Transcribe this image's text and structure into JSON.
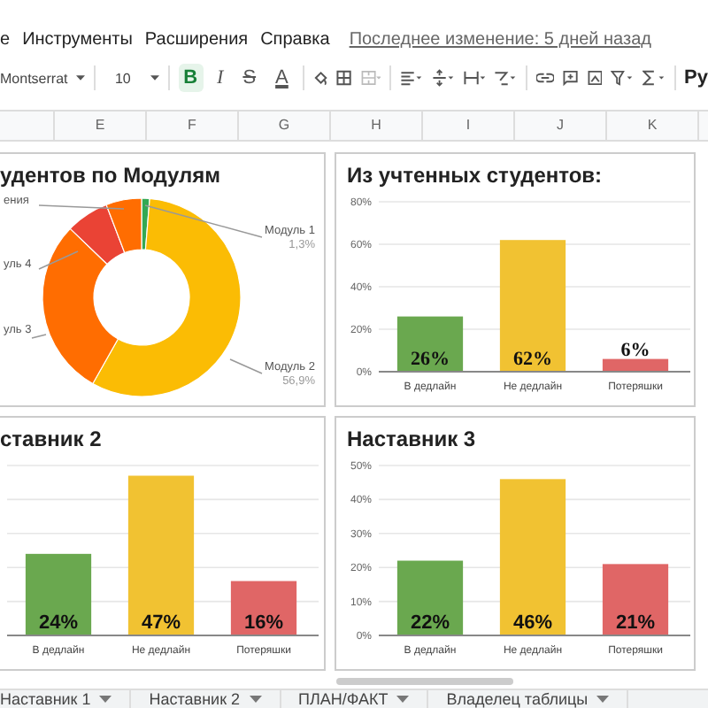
{
  "menu": {
    "items": [
      "е",
      "Инструменты",
      "Расширения",
      "Справка"
    ],
    "last_edit": "Последнее изменение: 5 дней назад"
  },
  "toolbar": {
    "font": "Montserrat",
    "size": "10",
    "format_buttons": [
      {
        "label": "B",
        "selected": true
      },
      {
        "label": "I",
        "selected": false
      },
      {
        "label": "S",
        "selected": false
      },
      {
        "label": "A",
        "selected": false
      }
    ],
    "overflow_text": "Py"
  },
  "columns": [
    "E",
    "F",
    "G",
    "H",
    "I",
    "J",
    "K"
  ],
  "charts": [
    {
      "kind": "donut",
      "title": "удентов по Модулям",
      "labels": [
        {
          "name": "ения"
        },
        {
          "name": "Модуль 1",
          "share": "1,3%"
        },
        {
          "name": "уль 4"
        },
        {
          "name": "уль 3"
        },
        {
          "name": "Модуль 2",
          "share": "56,9%"
        }
      ]
    },
    {
      "kind": "bar",
      "chart_data": {
        "type": "bar",
        "title": "Из учтенных студентов:",
        "grid": true,
        "categories": [
          "В дедлайн",
          "Не дедлайн",
          "Потеряшки"
        ],
        "values": [
          26,
          62,
          6
        ],
        "ylim": [
          0,
          80
        ],
        "yticks": [
          {
            "value": 0,
            "label": "0%"
          },
          {
            "value": 20,
            "label": "20%"
          },
          {
            "value": 40,
            "label": "40%"
          },
          {
            "value": 60,
            "label": "60%"
          },
          {
            "value": 80,
            "label": "80%"
          }
        ],
        "data_labels": true,
        "value_labels": [
          "26%",
          "62%",
          "6%"
        ],
        "colors": [
          "#6aa84f",
          "#f1c232",
          "#e06666"
        ]
      }
    },
    {
      "kind": "bar",
      "chart_data": {
        "type": "bar",
        "title": "ставник 2",
        "grid": true,
        "categories": [
          "В дедлайн",
          "Не дедлайн",
          "Потеряшки"
        ],
        "values": [
          24,
          47,
          16
        ],
        "ylim": [
          0,
          50
        ],
        "data_labels": true,
        "value_labels": [
          "24%",
          "47%",
          "16%"
        ],
        "colors": [
          "#6aa84f",
          "#f1c232",
          "#e06666"
        ]
      }
    },
    {
      "kind": "bar",
      "chart_data": {
        "type": "bar",
        "title": "Наставник 3",
        "grid": true,
        "categories": [
          "В дедлайн",
          "Не дедлайн",
          "Потеряшки"
        ],
        "values": [
          22,
          46,
          21
        ],
        "ylim": [
          0,
          50
        ],
        "yticks": [
          {
            "value": 0,
            "label": "0%"
          },
          {
            "value": 10,
            "label": "10%"
          },
          {
            "value": 20,
            "label": "20%"
          },
          {
            "value": 30,
            "label": "30%"
          },
          {
            "value": 40,
            "label": "40%"
          },
          {
            "value": 50,
            "label": "50%"
          }
        ],
        "data_labels": true,
        "value_labels": [
          "22%",
          "46%",
          "21%"
        ],
        "colors": [
          "#6aa84f",
          "#f1c232",
          "#e06666"
        ]
      }
    }
  ],
  "sheet_tabs": [
    {
      "label": "Наставник 1"
    },
    {
      "label": "Наставник 2"
    },
    {
      "label": "ПЛАН/ФАКТ"
    },
    {
      "label": "Владелец таблицы"
    }
  ]
}
